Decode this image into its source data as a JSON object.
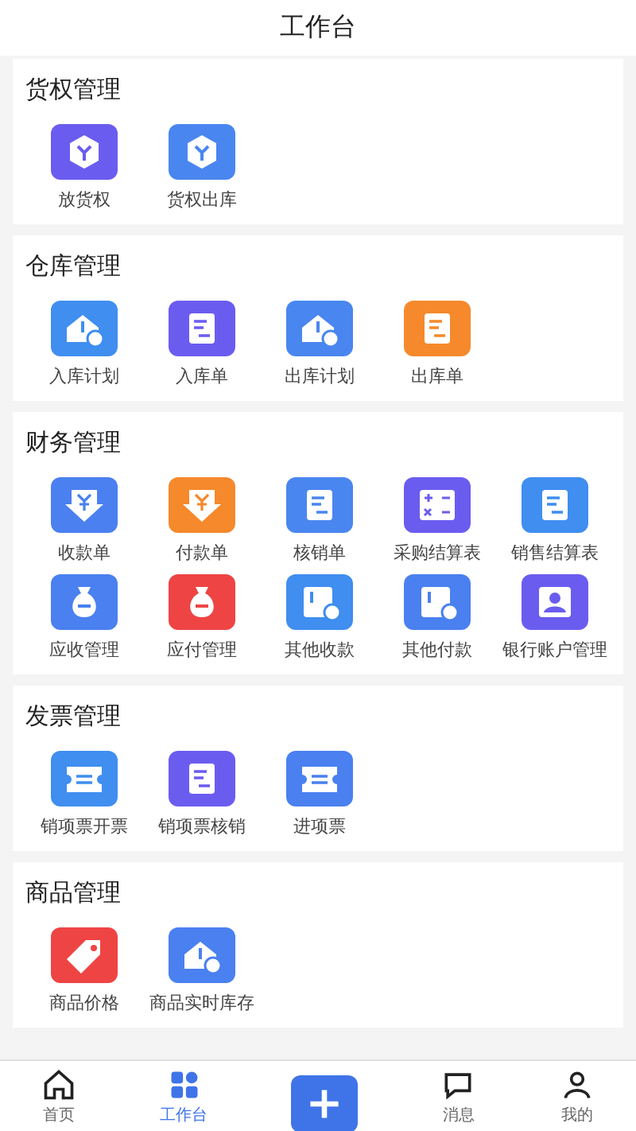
{
  "header": {
    "title": "工作台"
  },
  "sections": [
    {
      "title": "货权管理",
      "items": [
        {
          "label": "放货权",
          "color": "#6b5cf0"
        },
        {
          "label": "货权出库",
          "color": "#4a86f0"
        }
      ]
    },
    {
      "title": "仓库管理",
      "items": [
        {
          "label": "入库计划",
          "color": "#3f8ef0"
        },
        {
          "label": "入库单",
          "color": "#6b5cf0"
        },
        {
          "label": "出库计划",
          "color": "#4a86f0"
        },
        {
          "label": "出库单",
          "color": "#f5892c"
        }
      ]
    },
    {
      "title": "财务管理",
      "items": [
        {
          "label": "收款单",
          "color": "#4a80f0"
        },
        {
          "label": "付款单",
          "color": "#f5892c"
        },
        {
          "label": "核销单",
          "color": "#4a86f0"
        },
        {
          "label": "采购结算表",
          "color": "#6b5cf0"
        },
        {
          "label": "销售结算表",
          "color": "#3f8ef0"
        },
        {
          "label": "应收管理",
          "color": "#4a80f0"
        },
        {
          "label": "应付管理",
          "color": "#ee4444"
        },
        {
          "label": "其他收款",
          "color": "#3f8ef0"
        },
        {
          "label": "其他付款",
          "color": "#4a80f0"
        },
        {
          "label": "银行账户管理",
          "color": "#6b5cf0"
        }
      ]
    },
    {
      "title": "发票管理",
      "items": [
        {
          "label": "销项票开票",
          "color": "#3f8ef0"
        },
        {
          "label": "销项票核销",
          "color": "#6b5cf0"
        },
        {
          "label": "进项票",
          "color": "#4a80f0"
        }
      ]
    },
    {
      "title": "商品管理",
      "items": [
        {
          "label": "商品价格",
          "color": "#ee4444"
        },
        {
          "label": "商品实时库存",
          "color": "#4a80f0"
        }
      ]
    }
  ],
  "tabbar": [
    {
      "label": "首页",
      "selected": false
    },
    {
      "label": "工作台",
      "selected": true
    },
    {
      "kind": "add"
    },
    {
      "label": "消息",
      "selected": false
    },
    {
      "label": "我的",
      "selected": false
    }
  ]
}
